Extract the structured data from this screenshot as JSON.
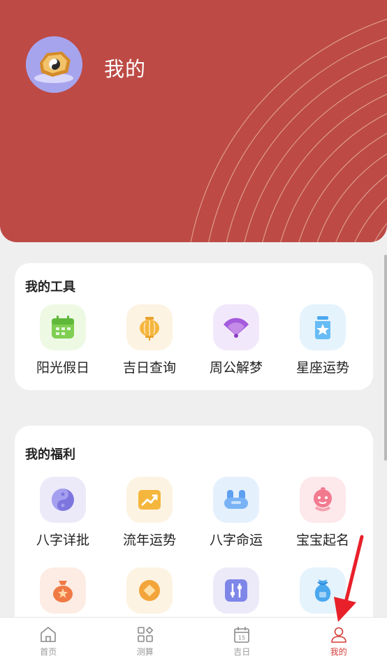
{
  "header": {
    "title": "我的",
    "background": "#bd4a45"
  },
  "tools": {
    "title": "我的工具",
    "items": [
      {
        "label": "阳光假日",
        "icon": "calendar-icon"
      },
      {
        "label": "吉日查询",
        "icon": "lantern-icon"
      },
      {
        "label": "周公解梦",
        "icon": "fan-icon"
      },
      {
        "label": "星座运势",
        "icon": "star-jar-icon"
      }
    ]
  },
  "welfare": {
    "title": "我的福利",
    "items": [
      {
        "label": "八字详批",
        "icon": "yin-yang-icon"
      },
      {
        "label": "流年运势",
        "icon": "trend-icon"
      },
      {
        "label": "八字命运",
        "icon": "cloud-icon"
      },
      {
        "label": "宝宝起名",
        "icon": "baby-icon"
      },
      {
        "label": "",
        "icon": "lucky-bag-icon"
      },
      {
        "label": "",
        "icon": "coin-icon"
      },
      {
        "label": "",
        "icon": "sliders-icon"
      },
      {
        "label": "",
        "icon": "vase-icon"
      }
    ]
  },
  "nav": {
    "items": [
      {
        "label": "首页",
        "icon": "home-icon"
      },
      {
        "label": "测算",
        "icon": "grid-icon"
      },
      {
        "label": "吉日",
        "icon": "calendar-icon",
        "badge": "15"
      },
      {
        "label": "我的",
        "icon": "user-icon",
        "active": true
      }
    ],
    "active_color": "#d53d39"
  }
}
